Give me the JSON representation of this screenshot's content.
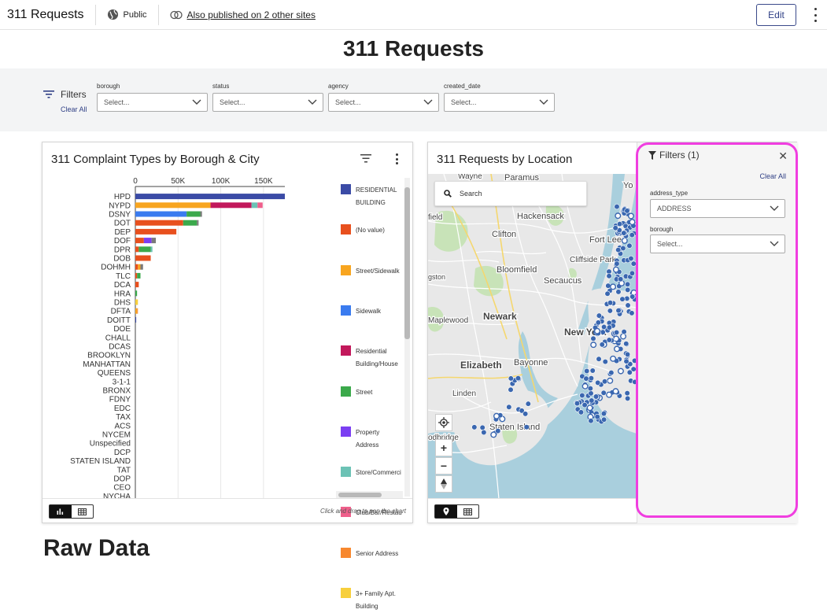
{
  "header": {
    "title": "311 Requests",
    "visibility": "Public",
    "published_link": "Also published on 2 other sites",
    "edit_label": "Edit"
  },
  "page": {
    "title": "311 Requests",
    "next_section": "Raw Data"
  },
  "filters": {
    "label": "Filters",
    "clear_all": "Clear All",
    "fields": [
      {
        "label": "borough",
        "placeholder": "Select..."
      },
      {
        "label": "status",
        "placeholder": "Select..."
      },
      {
        "label": "agency",
        "placeholder": "Select..."
      },
      {
        "label": "created_date",
        "placeholder": "Select..."
      }
    ]
  },
  "chart_card": {
    "title": "311 Complaint Types by Borough & City",
    "hint": "Click and drag to pan the chart"
  },
  "chart_data": {
    "type": "bar",
    "orientation": "horizontal",
    "stacked": true,
    "xlim": [
      0,
      175000
    ],
    "x_ticks": [
      "0",
      "50K",
      "100K",
      "150K"
    ],
    "x_tick_values": [
      0,
      50000,
      100000,
      150000
    ],
    "categories": [
      "HPD",
      "NYPD",
      "DSNY",
      "DOT",
      "DEP",
      "DOF",
      "DPR",
      "DOB",
      "DOHMH",
      "TLC",
      "DCA",
      "HRA",
      "DHS",
      "DFTA",
      "DOITT",
      "DOE",
      "CHALL",
      "DCAS",
      "BROOKLYN",
      "MANHATTAN",
      "QUEENS",
      "3-1-1",
      "BRONX",
      "FDNY",
      "EDC",
      "TAX",
      "ACS",
      "NYCEM",
      "Unspecified",
      "DCP",
      "STATEN ISLAND",
      "TAT",
      "DOP",
      "CEO",
      "NYCHA"
    ],
    "series": [
      {
        "name": "RESIDENTIAL BUILDING",
        "color": "#3b4ba6",
        "values": [
          175000,
          0,
          0,
          0,
          0,
          0,
          0,
          0,
          0,
          0,
          0,
          0,
          0,
          0,
          1000,
          0,
          0,
          0,
          0,
          0,
          0,
          0,
          0,
          0,
          0,
          0,
          0,
          0,
          0,
          0,
          0,
          0,
          0,
          0,
          0
        ]
      },
      {
        "name": "(No value)",
        "color": "#e8501e",
        "values": [
          0,
          0,
          0,
          56000,
          48000,
          10000,
          4000,
          18000,
          3000,
          2000,
          4000,
          0,
          0,
          0,
          0,
          0,
          0,
          0,
          0,
          0,
          0,
          0,
          0,
          0,
          0,
          0,
          0,
          0,
          0,
          0,
          0,
          0,
          0,
          0,
          0
        ]
      },
      {
        "name": "Street/Sidewalk",
        "color": "#f8a51f",
        "values": [
          0,
          88000,
          0,
          0,
          0,
          0,
          0,
          0,
          3000,
          0,
          0,
          0,
          0,
          2000,
          0,
          0,
          0,
          0,
          0,
          0,
          0,
          0,
          0,
          0,
          0,
          0,
          0,
          0,
          0,
          0,
          0,
          0,
          0,
          0,
          0
        ]
      },
      {
        "name": "Sidewalk",
        "color": "#3a7bef",
        "values": [
          0,
          0,
          60000,
          0,
          0,
          0,
          0,
          0,
          0,
          0,
          0,
          0,
          0,
          0,
          0,
          0,
          0,
          0,
          0,
          0,
          0,
          0,
          0,
          0,
          0,
          0,
          0,
          0,
          0,
          0,
          0,
          0,
          0,
          0,
          0
        ]
      },
      {
        "name": "Residential Building/House",
        "color": "#c2185b",
        "values": [
          0,
          48000,
          0,
          0,
          0,
          0,
          0,
          0,
          0,
          0,
          0,
          0,
          0,
          0,
          0,
          0,
          0,
          0,
          0,
          0,
          0,
          0,
          0,
          0,
          0,
          0,
          0,
          0,
          0,
          0,
          0,
          0,
          0,
          0,
          0
        ]
      },
      {
        "name": "Street",
        "color": "#3ba94b",
        "values": [
          0,
          0,
          16000,
          16000,
          0,
          0,
          14000,
          0,
          0,
          4000,
          0,
          2000,
          0,
          0,
          0,
          0,
          0,
          0,
          0,
          0,
          0,
          0,
          0,
          0,
          0,
          0,
          0,
          0,
          0,
          0,
          0,
          0,
          0,
          0,
          0
        ]
      },
      {
        "name": "Property Address",
        "color": "#7b3ff2",
        "values": [
          0,
          0,
          0,
          0,
          0,
          9000,
          0,
          0,
          0,
          0,
          0,
          0,
          0,
          0,
          0,
          0,
          0,
          0,
          0,
          0,
          0,
          0,
          0,
          0,
          0,
          0,
          0,
          0,
          0,
          0,
          0,
          0,
          0,
          0,
          0
        ]
      },
      {
        "name": "Store/Commercial",
        "color": "#6cc2b5",
        "values": [
          0,
          7000,
          0,
          0,
          0,
          0,
          2000,
          0,
          0,
          0,
          0,
          0,
          0,
          0,
          0,
          0,
          0,
          0,
          0,
          0,
          0,
          0,
          0,
          0,
          0,
          0,
          0,
          0,
          0,
          0,
          0,
          0,
          0,
          0,
          0
        ]
      },
      {
        "name": "Club/Bar/Restaurant",
        "color": "#ef5f8b",
        "values": [
          0,
          6000,
          0,
          0,
          0,
          0,
          0,
          0,
          0,
          0,
          0,
          0,
          0,
          0,
          0,
          0,
          0,
          0,
          0,
          0,
          0,
          0,
          0,
          0,
          0,
          0,
          0,
          0,
          0,
          0,
          0,
          0,
          0,
          0,
          0
        ]
      },
      {
        "name": "Senior Address",
        "color": "#f7882f",
        "values": [
          0,
          0,
          0,
          0,
          0,
          0,
          0,
          0,
          0,
          0,
          0,
          0,
          0,
          1000,
          0,
          0,
          0,
          0,
          0,
          0,
          0,
          0,
          0,
          0,
          0,
          0,
          0,
          0,
          0,
          0,
          0,
          0,
          0,
          0,
          0
        ]
      },
      {
        "name": "3+ Family Apt. Building",
        "color": "#f7cf3c",
        "values": [
          0,
          0,
          0,
          0,
          0,
          0,
          0,
          0,
          0,
          0,
          0,
          0,
          3000,
          0,
          0,
          0,
          0,
          0,
          0,
          0,
          0,
          0,
          0,
          0,
          0,
          0,
          0,
          0,
          0,
          0,
          0,
          0,
          0,
          0,
          0
        ]
      },
      {
        "name": "",
        "color": "#7a7a7a",
        "values": [
          0,
          0,
          2000,
          2000,
          0,
          5000,
          0,
          0,
          3000,
          0,
          0,
          0,
          0,
          0,
          0,
          0,
          0,
          0,
          0,
          0,
          0,
          0,
          0,
          0,
          0,
          0,
          0,
          0,
          0,
          0,
          0,
          0,
          0,
          0,
          0
        ]
      }
    ],
    "legend": [
      "RESIDENTIAL BUILDING",
      "(No value)",
      "Street/Sidewalk",
      "Sidewalk",
      "Residential Building/House",
      "Street",
      "Property Address",
      "Store/Commercial",
      "Club/Bar/Restaurant",
      "Senior Address",
      "3+ Family Apt. Building"
    ],
    "legend_display": [
      "RESIDENTIAL BUILDING",
      "(No value)",
      "Street/Sidewalk",
      "Sidewalk",
      "Residential Building/House",
      "Street",
      "Property Address",
      "Store/Commerci",
      "Club/Bar/Restau",
      "Senior Address",
      "3+ Family Apt. Building"
    ],
    "legend_position": "right",
    "grid": true
  },
  "map_card": {
    "title": "311 Requests by Location",
    "search_label": "Search",
    "labels": [
      "Wayne",
      "Paramus",
      "Yo",
      "field",
      "Hackensack",
      "Clifton",
      "Fort Lee",
      "Cliffside Park",
      "Bloomfield",
      "gston",
      "Secaucus",
      "Maplewood",
      "Newark",
      "New York",
      "Elizabeth",
      "Bayonne",
      "Linden",
      "Staten Island",
      "odbridge"
    ],
    "zoom_in": "+",
    "zoom_out": "−"
  },
  "map_filter_panel": {
    "title": "Filters (1)",
    "clear_all": "Clear All",
    "fields": [
      {
        "label": "address_type",
        "value": "ADDRESS"
      },
      {
        "label": "borough",
        "placeholder": "Select..."
      }
    ]
  },
  "colors": {
    "accent": "#2f3f85",
    "highlight": "#f03ee0",
    "point": "#3a67b0"
  }
}
